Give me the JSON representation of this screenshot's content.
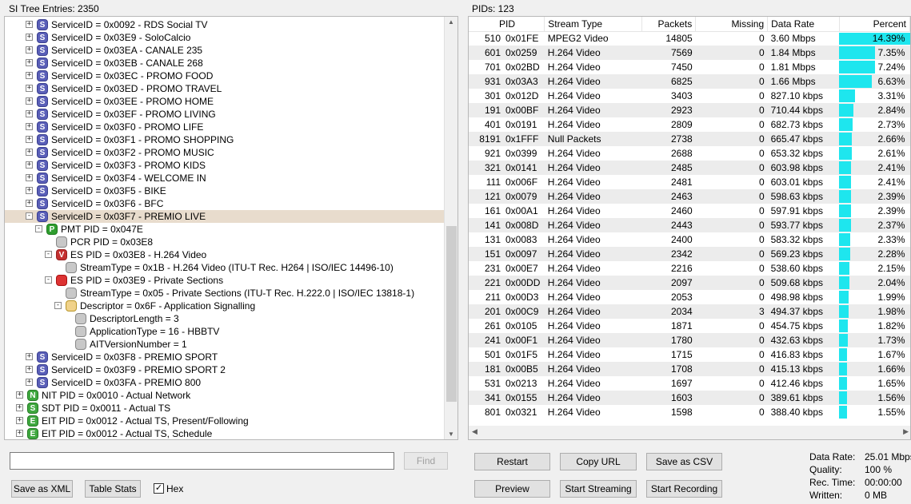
{
  "left_panel": {
    "title": "SI Tree Entries: 2350",
    "tree": [
      {
        "indent": 0,
        "exp": "+",
        "icon": "S",
        "label": "ServiceID = 0x0092 - RDS Social TV"
      },
      {
        "indent": 0,
        "exp": "+",
        "icon": "S",
        "label": "ServiceID = 0x03E9 - SoloCalcio"
      },
      {
        "indent": 0,
        "exp": "+",
        "icon": "S",
        "label": "ServiceID = 0x03EA - CANALE 235"
      },
      {
        "indent": 0,
        "exp": "+",
        "icon": "S",
        "label": "ServiceID = 0x03EB - CANALE 268"
      },
      {
        "indent": 0,
        "exp": "+",
        "icon": "S",
        "label": "ServiceID = 0x03EC - PROMO FOOD"
      },
      {
        "indent": 0,
        "exp": "+",
        "icon": "S",
        "label": "ServiceID = 0x03ED - PROMO TRAVEL"
      },
      {
        "indent": 0,
        "exp": "+",
        "icon": "S",
        "label": "ServiceID = 0x03EE - PROMO HOME"
      },
      {
        "indent": 0,
        "exp": "+",
        "icon": "S",
        "label": "ServiceID = 0x03EF - PROMO LIVING"
      },
      {
        "indent": 0,
        "exp": "+",
        "icon": "S",
        "label": "ServiceID = 0x03F0 - PROMO LIFE"
      },
      {
        "indent": 0,
        "exp": "+",
        "icon": "S",
        "label": "ServiceID = 0x03F1 - PROMO SHOPPING"
      },
      {
        "indent": 0,
        "exp": "+",
        "icon": "S",
        "label": "ServiceID = 0x03F2 - PROMO MUSIC"
      },
      {
        "indent": 0,
        "exp": "+",
        "icon": "S",
        "label": "ServiceID = 0x03F3 - PROMO KIDS"
      },
      {
        "indent": 0,
        "exp": "+",
        "icon": "S",
        "label": "ServiceID = 0x03F4 - WELCOME IN"
      },
      {
        "indent": 0,
        "exp": "+",
        "icon": "S",
        "label": "ServiceID = 0x03F5 - BIKE"
      },
      {
        "indent": 0,
        "exp": "+",
        "icon": "S",
        "label": "ServiceID = 0x03F6 - BFC"
      },
      {
        "indent": 0,
        "exp": "-",
        "icon": "S",
        "label": "ServiceID = 0x03F7 - PREMIO LIVE",
        "selected": true
      },
      {
        "indent": 1,
        "exp": "-",
        "icon": "P",
        "label": "PMT PID = 0x047E"
      },
      {
        "indent": 2,
        "exp": "",
        "icon": "gray",
        "label": "PCR PID = 0x03E8"
      },
      {
        "indent": 2,
        "exp": "-",
        "icon": "V",
        "label": "ES PID = 0x03E8 - H.264 Video"
      },
      {
        "indent": 3,
        "exp": "",
        "icon": "gray",
        "label": "StreamType = 0x1B - H.264 Video (ITU-T Rec. H264 | ISO/IEC 14496-10)"
      },
      {
        "indent": 2,
        "exp": "-",
        "icon": "red",
        "label": "ES PID = 0x03E9 - Private Sections"
      },
      {
        "indent": 3,
        "exp": "",
        "icon": "gray",
        "label": "StreamType = 0x05 - Private Sections (ITU-T Rec. H.222.0 | ISO/IEC 13818-1)"
      },
      {
        "indent": 3,
        "exp": "-",
        "icon": "gold",
        "label": "Descriptor = 0x6F - Application Signalling"
      },
      {
        "indent": 4,
        "exp": "",
        "icon": "gray",
        "label": "DescriptorLength = 3"
      },
      {
        "indent": 4,
        "exp": "",
        "icon": "gray",
        "label": "ApplicationType = 16 - HBBTV"
      },
      {
        "indent": 4,
        "exp": "",
        "icon": "gray",
        "label": "AITVersionNumber = 1"
      },
      {
        "indent": 0,
        "exp": "+",
        "icon": "S",
        "label": "ServiceID = 0x03F8 - PREMIO SPORT"
      },
      {
        "indent": 0,
        "exp": "+",
        "icon": "S",
        "label": "ServiceID = 0x03F9 - PREMIO SPORT 2"
      },
      {
        "indent": 0,
        "exp": "+",
        "icon": "S",
        "label": "ServiceID = 0x03FA - PREMIO 800"
      },
      {
        "indent": -1,
        "exp": "+",
        "icon": "N",
        "label": "NIT PID = 0x0010 - Actual Network"
      },
      {
        "indent": -1,
        "exp": "+",
        "icon": "Sg",
        "label": "SDT PID = 0x0011 - Actual TS"
      },
      {
        "indent": -1,
        "exp": "+",
        "icon": "E",
        "label": "EIT PID = 0x0012 - Actual TS, Present/Following"
      },
      {
        "indent": -1,
        "exp": "+",
        "icon": "E",
        "label": "EIT PID = 0x0012 - Actual TS, Schedule"
      }
    ],
    "search_value": "",
    "find_label": "Find",
    "save_xml_label": "Save as XML",
    "table_stats_label": "Table Stats",
    "hex_label": "Hex",
    "hex_checked": true
  },
  "right_panel": {
    "title": "PIDs: 123",
    "columns": [
      "PID",
      "Stream Type",
      "Packets",
      "Missing",
      "Data Rate",
      "Percent"
    ],
    "rows": [
      {
        "pid": "510",
        "hex": "0x01FE",
        "type": "MPEG2 Video",
        "packets": "14805",
        "missing": "0",
        "rate": "3.60 Mbps",
        "percent": "14.39%",
        "pct": 14.39
      },
      {
        "pid": "601",
        "hex": "0x0259",
        "type": "H.264 Video",
        "packets": "7569",
        "missing": "0",
        "rate": "1.84 Mbps",
        "percent": "7.35%",
        "pct": 7.35
      },
      {
        "pid": "701",
        "hex": "0x02BD",
        "type": "H.264 Video",
        "packets": "7450",
        "missing": "0",
        "rate": "1.81 Mbps",
        "percent": "7.24%",
        "pct": 7.24
      },
      {
        "pid": "931",
        "hex": "0x03A3",
        "type": "H.264 Video",
        "packets": "6825",
        "missing": "0",
        "rate": "1.66 Mbps",
        "percent": "6.63%",
        "pct": 6.63
      },
      {
        "pid": "301",
        "hex": "0x012D",
        "type": "H.264 Video",
        "packets": "3403",
        "missing": "0",
        "rate": "827.10 kbps",
        "percent": "3.31%",
        "pct": 3.31
      },
      {
        "pid": "191",
        "hex": "0x00BF",
        "type": "H.264 Video",
        "packets": "2923",
        "missing": "0",
        "rate": "710.44 kbps",
        "percent": "2.84%",
        "pct": 2.84
      },
      {
        "pid": "401",
        "hex": "0x0191",
        "type": "H.264 Video",
        "packets": "2809",
        "missing": "0",
        "rate": "682.73 kbps",
        "percent": "2.73%",
        "pct": 2.73
      },
      {
        "pid": "8191",
        "hex": "0x1FFF",
        "type": "Null Packets",
        "packets": "2738",
        "missing": "0",
        "rate": "665.47 kbps",
        "percent": "2.66%",
        "pct": 2.66
      },
      {
        "pid": "921",
        "hex": "0x0399",
        "type": "H.264 Video",
        "packets": "2688",
        "missing": "0",
        "rate": "653.32 kbps",
        "percent": "2.61%",
        "pct": 2.61
      },
      {
        "pid": "321",
        "hex": "0x0141",
        "type": "H.264 Video",
        "packets": "2485",
        "missing": "0",
        "rate": "603.98 kbps",
        "percent": "2.41%",
        "pct": 2.41
      },
      {
        "pid": "111",
        "hex": "0x006F",
        "type": "H.264 Video",
        "packets": "2481",
        "missing": "0",
        "rate": "603.01 kbps",
        "percent": "2.41%",
        "pct": 2.41
      },
      {
        "pid": "121",
        "hex": "0x0079",
        "type": "H.264 Video",
        "packets": "2463",
        "missing": "0",
        "rate": "598.63 kbps",
        "percent": "2.39%",
        "pct": 2.39
      },
      {
        "pid": "161",
        "hex": "0x00A1",
        "type": "H.264 Video",
        "packets": "2460",
        "missing": "0",
        "rate": "597.91 kbps",
        "percent": "2.39%",
        "pct": 2.39
      },
      {
        "pid": "141",
        "hex": "0x008D",
        "type": "H.264 Video",
        "packets": "2443",
        "missing": "0",
        "rate": "593.77 kbps",
        "percent": "2.37%",
        "pct": 2.37
      },
      {
        "pid": "131",
        "hex": "0x0083",
        "type": "H.264 Video",
        "packets": "2400",
        "missing": "0",
        "rate": "583.32 kbps",
        "percent": "2.33%",
        "pct": 2.33
      },
      {
        "pid": "151",
        "hex": "0x0097",
        "type": "H.264 Video",
        "packets": "2342",
        "missing": "0",
        "rate": "569.23 kbps",
        "percent": "2.28%",
        "pct": 2.28
      },
      {
        "pid": "231",
        "hex": "0x00E7",
        "type": "H.264 Video",
        "packets": "2216",
        "missing": "0",
        "rate": "538.60 kbps",
        "percent": "2.15%",
        "pct": 2.15
      },
      {
        "pid": "221",
        "hex": "0x00DD",
        "type": "H.264 Video",
        "packets": "2097",
        "missing": "0",
        "rate": "509.68 kbps",
        "percent": "2.04%",
        "pct": 2.04
      },
      {
        "pid": "211",
        "hex": "0x00D3",
        "type": "H.264 Video",
        "packets": "2053",
        "missing": "0",
        "rate": "498.98 kbps",
        "percent": "1.99%",
        "pct": 1.99
      },
      {
        "pid": "201",
        "hex": "0x00C9",
        "type": "H.264 Video",
        "packets": "2034",
        "missing": "3",
        "rate": "494.37 kbps",
        "percent": "1.98%",
        "pct": 1.98
      },
      {
        "pid": "261",
        "hex": "0x0105",
        "type": "H.264 Video",
        "packets": "1871",
        "missing": "0",
        "rate": "454.75 kbps",
        "percent": "1.82%",
        "pct": 1.82
      },
      {
        "pid": "241",
        "hex": "0x00F1",
        "type": "H.264 Video",
        "packets": "1780",
        "missing": "0",
        "rate": "432.63 kbps",
        "percent": "1.73%",
        "pct": 1.73
      },
      {
        "pid": "501",
        "hex": "0x01F5",
        "type": "H.264 Video",
        "packets": "1715",
        "missing": "0",
        "rate": "416.83 kbps",
        "percent": "1.67%",
        "pct": 1.67
      },
      {
        "pid": "181",
        "hex": "0x00B5",
        "type": "H.264 Video",
        "packets": "1708",
        "missing": "0",
        "rate": "415.13 kbps",
        "percent": "1.66%",
        "pct": 1.66
      },
      {
        "pid": "531",
        "hex": "0x0213",
        "type": "H.264 Video",
        "packets": "1697",
        "missing": "0",
        "rate": "412.46 kbps",
        "percent": "1.65%",
        "pct": 1.65
      },
      {
        "pid": "341",
        "hex": "0x0155",
        "type": "H.264 Video",
        "packets": "1603",
        "missing": "0",
        "rate": "389.61 kbps",
        "percent": "1.56%",
        "pct": 1.56
      },
      {
        "pid": "801",
        "hex": "0x0321",
        "type": "H.264 Video",
        "packets": "1598",
        "missing": "0",
        "rate": "388.40 kbps",
        "percent": "1.55%",
        "pct": 1.55
      }
    ],
    "bar_color": "#1ee6ee",
    "buttons": {
      "restart": "Restart",
      "copy_url": "Copy URL",
      "save_csv": "Save as CSV",
      "preview": "Preview",
      "start_streaming": "Start Streaming",
      "start_recording": "Start Recording"
    },
    "stats": [
      {
        "label": "Data Rate:",
        "value": "25.01 Mbps"
      },
      {
        "label": "Quality:",
        "value": "100 %"
      },
      {
        "label": "Rec. Time:",
        "value": "00:00:00"
      },
      {
        "label": "Written:",
        "value": "0 MB"
      }
    ]
  }
}
